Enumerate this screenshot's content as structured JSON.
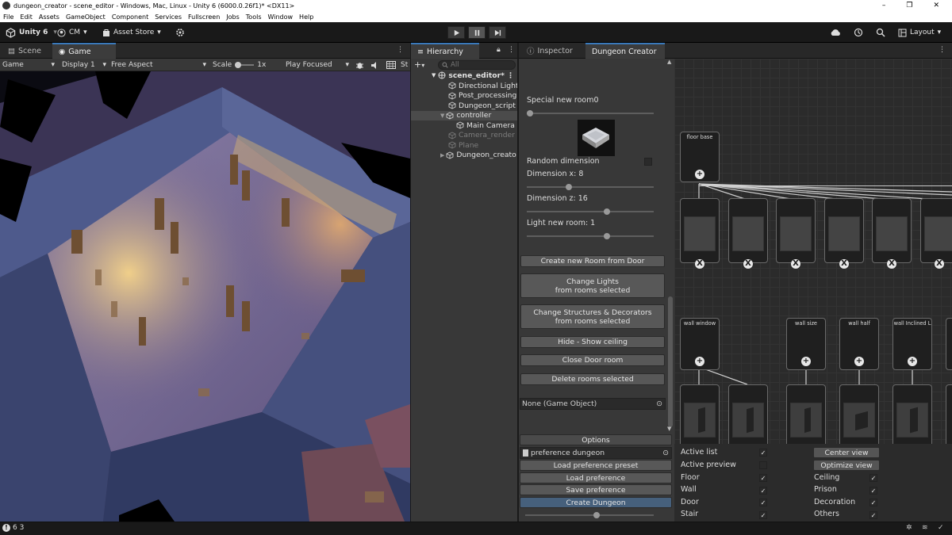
{
  "window": {
    "title": "dungeon_creator - scene_editor - Windows, Mac, Linux - Unity 6 (6000.0.26f1)* <DX11>",
    "minimize": "–",
    "restore": "❐",
    "close": "✕"
  },
  "menu": [
    "File",
    "Edit",
    "Assets",
    "GameObject",
    "Component",
    "Services",
    "Fullscreen",
    "Jobs",
    "Tools",
    "Window",
    "Help"
  ],
  "toolbar": {
    "brand": "Unity 6",
    "account": "CM",
    "asset_store": "Asset Store",
    "layout": "Layout"
  },
  "tabs": {
    "scene": "Scene",
    "game": "Game",
    "hierarchy": "Hierarchy",
    "inspector": "Inspector",
    "dungeon_creator": "Dungeon Creator"
  },
  "gamebar": {
    "mode": "Game",
    "display": "Display 1",
    "aspect": "Free Aspect",
    "scale_label": "Scale",
    "scale_value": "1x",
    "play_focused": "Play Focused",
    "stats": "St"
  },
  "hierarchy": {
    "search_placeholder": "All",
    "items": [
      {
        "label": "scene_editor*"
      },
      {
        "label": "Directional Light"
      },
      {
        "label": "Post_processing"
      },
      {
        "label": "Dungeon_script"
      },
      {
        "label": "controller"
      },
      {
        "label": "Main Camera"
      },
      {
        "label": "Camera_render"
      },
      {
        "label": "Plane"
      },
      {
        "label": "Dungeon_creato"
      }
    ]
  },
  "creator": {
    "special_room": "Special new room0",
    "special_room_value": 0,
    "random_dimension": "Random dimension",
    "random_dimension_checked": false,
    "dimension_x": "Dimension x: 8",
    "dimension_x_value": 8,
    "dimension_z": "Dimension z: 16",
    "dimension_z_value": 16,
    "light_new_room": "Light new room: 1",
    "light_new_room_value": 1,
    "buttons": {
      "create_room": "Create new Room from Door",
      "change_lights_1": "Change Lights",
      "change_lights_2": "from rooms selected",
      "change_struct_1": "Change Structures & Decorators",
      "change_struct_2": "from rooms selected",
      "hide_ceiling": "Hide - Show ceiling",
      "close_door": "Close Door room",
      "delete_rooms": "Delete rooms selected"
    },
    "object_field": "None (Game Object)",
    "options_header": "Options",
    "preference_field": "preference dungeon",
    "load_preset": "Load preference preset",
    "load_pref": "Load preference",
    "save_pref": "Save preference",
    "create_dungeon": "Create Dungeon"
  },
  "graph": {
    "floor_node": "floor base",
    "wall_nodes": [
      "wall window",
      "wall size",
      "wall half",
      "wall Inclined L"
    ],
    "add_glyph": "+",
    "remove_glyph": "X"
  },
  "options": {
    "active_list": "Active list",
    "active_list_checked": true,
    "active_preview": "Active preview",
    "active_preview_checked": false,
    "floor": "Floor",
    "floor_checked": true,
    "wall": "Wall",
    "wall_checked": true,
    "door": "Door",
    "door_checked": true,
    "stair": "Stair",
    "stair_checked": true,
    "ceiling": "Ceiling",
    "ceiling_checked": true,
    "prison": "Prison",
    "prison_checked": true,
    "decoration": "Decoration",
    "decoration_checked": true,
    "others": "Others",
    "others_checked": true,
    "center_view": "Center view",
    "optimize_view": "Optimize view"
  },
  "status": {
    "counts": "6 3"
  },
  "colors": {
    "accent_blue": "#3a79bb",
    "create_button": "#46607c",
    "panel": "#383838",
    "background": "#191919"
  },
  "icons": [
    "unity-logo-icon",
    "account-icon",
    "asset-store-icon",
    "settings-icon",
    "play-icon",
    "pause-icon",
    "step-icon",
    "cloud-icon",
    "history-icon",
    "search-icon",
    "layout-icon",
    "gizmo-icon",
    "cube-icon",
    "checkmark-icon",
    "plus-icon",
    "close-x-icon",
    "target-icon",
    "warning-icon"
  ]
}
